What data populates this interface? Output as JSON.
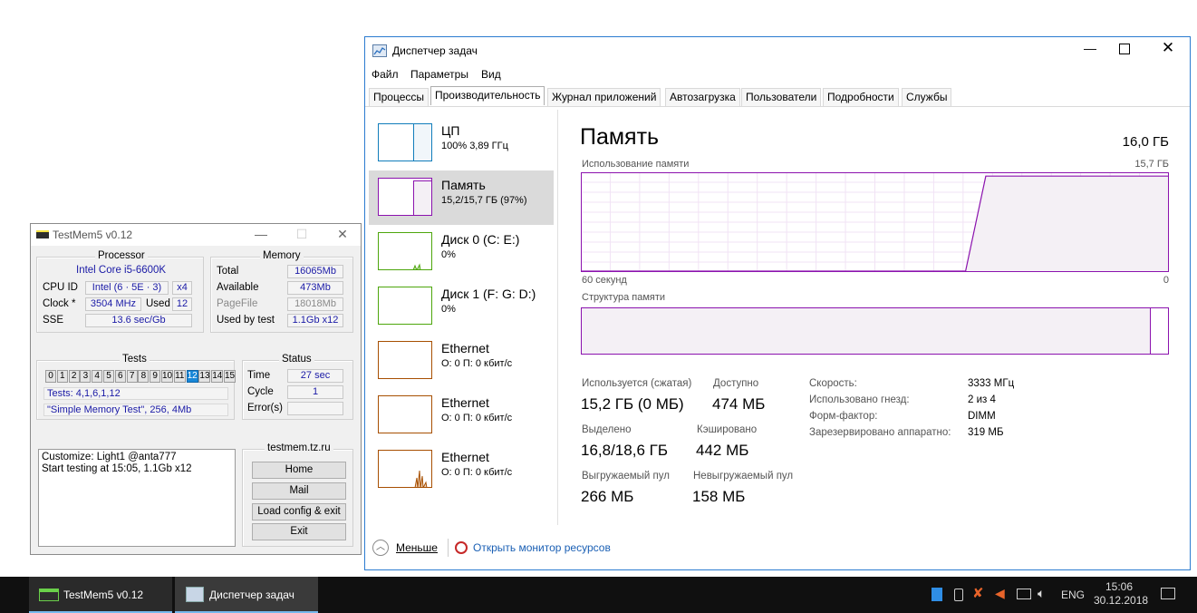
{
  "testmem": {
    "title": "TestMem5 v0.12",
    "processor": {
      "group": "Processor",
      "cpu_name": "Intel Core i5-6600K",
      "cpu_id_label": "CPU ID",
      "cpu_id_value": "Intel (6 · 5E · 3)",
      "cores": "x4",
      "clock_label": "Clock *",
      "clock_value": "3504 MHz",
      "used_label": "Used",
      "used_value": "12",
      "sse_label": "SSE",
      "sse_value": "13.6 sec/Gb"
    },
    "memory": {
      "group": "Memory",
      "total_label": "Total",
      "total_value": "16065Mb",
      "available_label": "Available",
      "available_value": "473Mb",
      "pagefile_label": "PageFile",
      "pagefile_value": "18018Mb",
      "used_by_test_label": "Used by test",
      "used_by_test_value": "1.1Gb x12"
    },
    "tests": {
      "group": "Tests",
      "numbers": [
        "0",
        "1",
        "2",
        "3",
        "4",
        "5",
        "6",
        "7",
        "8",
        "9",
        "10",
        "11",
        "12",
        "13",
        "14",
        "15"
      ],
      "active": "12",
      "list": "Tests: 4,1,6,1,12",
      "current": "\"Simple Memory Test\", 256, 4Mb"
    },
    "status": {
      "group": "Status",
      "time_label": "Time",
      "time_value": "27 sec",
      "cycle_label": "Cycle",
      "cycle_value": "1",
      "errors_label": "Error(s)",
      "errors_value": ""
    },
    "log": {
      "line1": "Customize: Light1 @anta777",
      "line2": "Start testing at 15:05, 1.1Gb x12"
    },
    "links": {
      "site": "testmem.tz.ru",
      "home": "Home",
      "mail": "Mail",
      "load_config": "Load config & exit",
      "exit": "Exit"
    }
  },
  "taskmgr": {
    "title": "Диспетчер задач",
    "menu": [
      "Файл",
      "Параметры",
      "Вид"
    ],
    "tabs": [
      "Процессы",
      "Производительность",
      "Журнал приложений",
      "Автозагрузка",
      "Пользователи",
      "Подробности",
      "Службы"
    ],
    "active_tab": "Производительность",
    "sidebar": [
      {
        "name": "ЦП",
        "sub": "100%  3,89 ГГц"
      },
      {
        "name": "Память",
        "sub": "15,2/15,7 ГБ (97%)"
      },
      {
        "name": "Диск 0 (C: E:)",
        "sub": "0%"
      },
      {
        "name": "Диск 1 (F: G: D:)",
        "sub": "0%"
      },
      {
        "name": "Ethernet",
        "sub": "О: 0 П: 0 кбит/с"
      },
      {
        "name": "Ethernet",
        "sub": "О: 0 П: 0 кбит/с"
      },
      {
        "name": "Ethernet",
        "sub": "О: 0 П: 0 кбит/с"
      }
    ],
    "memory": {
      "heading": "Память",
      "total": "16,0 ГБ",
      "usage_label": "Использование памяти",
      "usage_max": "15,7 ГБ",
      "time_left": "60 секунд",
      "time_right": "0",
      "composition_label": "Структура памяти",
      "usage_fraction_history": [
        0,
        0,
        0,
        0,
        0,
        0,
        0,
        0,
        0,
        0,
        0,
        0,
        0,
        0,
        0,
        0,
        0,
        0,
        0,
        0,
        0.97,
        0.97,
        0.97,
        0.97,
        0.97,
        0.97,
        0.97,
        0.97,
        0.97,
        0.97
      ],
      "in_use_fraction": 0.97,
      "stats": {
        "in_use_label": "Используется (сжатая)",
        "in_use_value": "15,2 ГБ (0 МБ)",
        "available_label": "Доступно",
        "available_value": "474 МБ",
        "committed_label": "Выделено",
        "committed_value": "16,8/18,6 ГБ",
        "cached_label": "Кэшировано",
        "cached_value": "442 МБ",
        "paged_label": "Выгружаемый пул",
        "paged_value": "266 МБ",
        "nonpaged_label": "Невыгружаемый пул",
        "nonpaged_value": "158 МБ"
      },
      "details": [
        {
          "label": "Скорость:",
          "value": "3333 МГц"
        },
        {
          "label": "Использовано гнезд:",
          "value": "2 из 4"
        },
        {
          "label": "Форм-фактор:",
          "value": "DIMM"
        },
        {
          "label": "Зарезервировано аппаратно:",
          "value": "319 МБ"
        }
      ]
    },
    "footer": {
      "less": "Меньше",
      "resmon": "Открыть монитор ресурсов"
    }
  },
  "taskbar": {
    "apps": [
      "TestMem5 v0.12",
      "Диспетчер задач"
    ],
    "lang": "ENG",
    "time": "15:06",
    "date": "30.12.2018"
  },
  "colors": {
    "memory_accent": "#8b12ae",
    "cpu_accent": "#117dbb",
    "disk_accent": "#4da60c",
    "eth_accent": "#a74f01",
    "testmem_active_test": "#1887d8"
  }
}
